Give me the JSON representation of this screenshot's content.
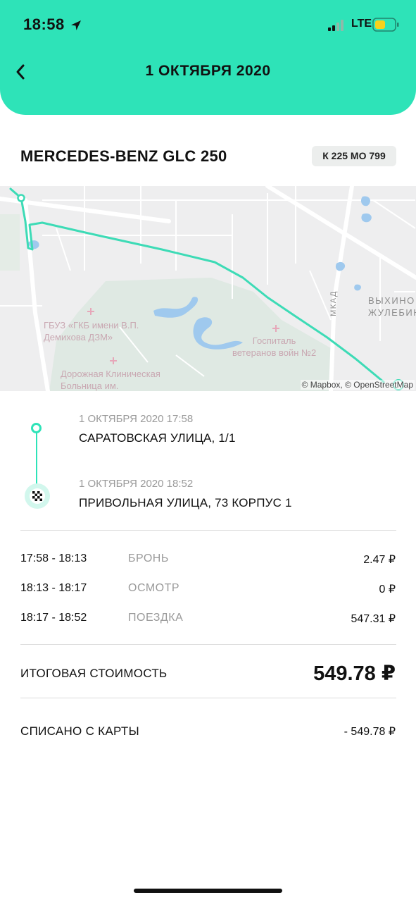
{
  "status_bar": {
    "time": "18:58",
    "network": "LTE"
  },
  "header": {
    "title": "1 ОКТЯБРЯ 2020"
  },
  "car": {
    "name": "MERCEDES-BENZ GLC 250",
    "plate": "К 225 МО 799"
  },
  "map": {
    "labels": {
      "hospital1_line1": "ГБУЗ «ГКБ имени В.П.",
      "hospital1_line2": "Демихова ДЗМ»",
      "hospital2_line1": "Дорожная Клиническая",
      "hospital2_line2": "Больница им.",
      "hospital3_line1": "Госпиталь",
      "hospital3_line2": "ветеранов войн №2",
      "district_line1": "ВЫХИНО",
      "district_line2": "ЖУЛЕБИН",
      "road": "МКАД"
    },
    "attribution": "© Mapbox, © OpenStreetMap",
    "route_color": "#3ddbb6"
  },
  "trip": {
    "start": {
      "date": "1 ОКТЯБРЯ 2020 17:58",
      "address": "САРАТОВСКАЯ УЛИЦА, 1/1"
    },
    "end": {
      "date": "1 ОКТЯБРЯ 2020 18:52",
      "address": "ПРИВОЛЬНАЯ УЛИЦА, 73 КОРПУС 1"
    }
  },
  "costs": [
    {
      "time": "17:58 - 18:13",
      "label": "БРОНЬ",
      "price": "2.47 ₽"
    },
    {
      "time": "18:13 - 18:17",
      "label": "ОСМОТР",
      "price": "0 ₽"
    },
    {
      "time": "18:17 - 18:52",
      "label": "ПОЕЗДКА",
      "price": "547.31 ₽"
    }
  ],
  "total": {
    "label": "ИТОГОВАЯ СТОИМОСТЬ",
    "value": "549.78 ₽"
  },
  "charged": {
    "label": "СПИСАНО С КАРТЫ",
    "value": "- 549.78 ₽"
  },
  "colors": {
    "accent": "#2ee3b8",
    "map_bg": "#eeeeef",
    "water": "#9fc9ee"
  }
}
